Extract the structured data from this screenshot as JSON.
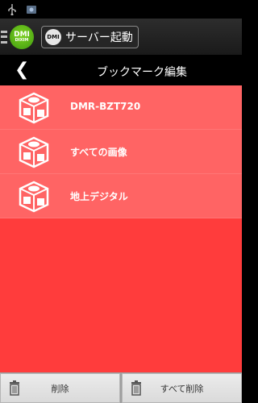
{
  "status_bar": {
    "icons": [
      "usb-icon",
      "image-notification-icon"
    ]
  },
  "action_bar": {
    "logo": {
      "main": "DMI",
      "sub": "DIXIM"
    },
    "server_button": {
      "badge": "DMI",
      "label": "サーバー起動"
    }
  },
  "title_bar": {
    "back_glyph": "❮",
    "title": "ブックマーク編集"
  },
  "bookmarks": [
    {
      "label": "DMR-BZT720"
    },
    {
      "label": "すべての画像"
    },
    {
      "label": "地上デジタル"
    }
  ],
  "bottom_bar": {
    "delete_label": "削除",
    "delete_all_label": "すべて削除"
  },
  "colors": {
    "list_bg": "#ff6464",
    "content_bg": "#ff3c3c",
    "accent_green": "#5ab81b"
  }
}
